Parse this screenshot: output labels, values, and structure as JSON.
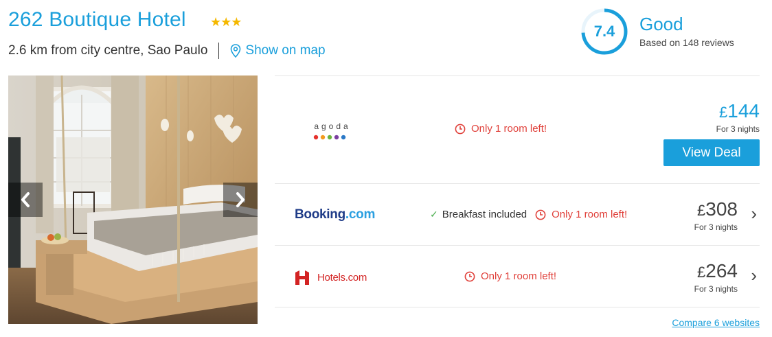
{
  "hotel": {
    "name": "262 Boutique Hotel",
    "star_count": 3,
    "stars_text": "★★★",
    "distance": "2.6 km from city centre, Sao Paulo",
    "map_link": "Show on map"
  },
  "rating": {
    "score": "7.4",
    "score_fraction": 0.74,
    "label": "Good",
    "reviews": "Based on 148 reviews"
  },
  "gallery": {
    "prev_icon": "chevron-left-icon",
    "next_icon": "chevron-right-icon"
  },
  "deals": [
    {
      "provider": "agoda",
      "note": "Only 1 room left!",
      "currency": "£",
      "price": "144",
      "nights": "For 3 nights",
      "button": "View Deal"
    },
    {
      "provider": "Booking.com",
      "logo_main": "Booking",
      "logo_suffix": ".com",
      "extra": "Breakfast included",
      "note": "Only 1 room left!",
      "currency": "£",
      "price": "308",
      "nights": "For 3 nights"
    },
    {
      "provider": "Hotels.com",
      "logo_text": "Hotels.com",
      "note": "Only 1 room left!",
      "currency": "£",
      "price": "264",
      "nights": "For 3 nights"
    }
  ],
  "compare_link": "Compare 6 websites",
  "colors": {
    "accent": "#1a9fdb",
    "stars": "#f5b800",
    "alert": "#e0403a",
    "check": "#4caf50"
  }
}
